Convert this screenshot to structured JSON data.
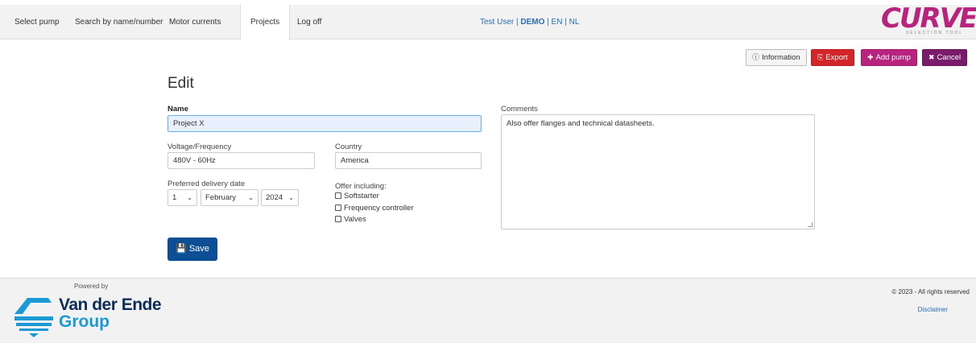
{
  "nav": {
    "items": [
      {
        "label": "Select pump",
        "active": false
      },
      {
        "label": "Search by name/number",
        "active": false
      },
      {
        "label": "Motor currents",
        "active": false
      },
      {
        "label": "Projects",
        "active": true
      },
      {
        "label": "Log off",
        "active": false
      }
    ],
    "user": "Test User",
    "sep1": " | ",
    "account": "DEMO",
    "lang_en": "EN",
    "sep2": " | ",
    "lang_nl": "NL"
  },
  "logo": {
    "text": "CURVES",
    "subtitle": "SELECTION TOOL"
  },
  "actions": {
    "information": "Information",
    "export": "Export",
    "add_pump": "Add pump",
    "cancel": "Cancel"
  },
  "form": {
    "heading": "Edit",
    "name_label": "Name",
    "name_value": "Project X",
    "voltage_label": "Voltage/Frequency",
    "voltage_value": "480V - 60Hz",
    "country_label": "Country",
    "country_value": "America",
    "delivery_label": "Preferred delivery date",
    "day": "1",
    "month": "February",
    "year": "2024",
    "offer_label": "Offer including:",
    "options": [
      "Softstarter",
      "Frequency controller",
      "Valves"
    ],
    "comments_label": "Comments",
    "comments_value": "Also offer flanges and technical datasheets.",
    "save_label": "Save"
  },
  "footer": {
    "powered_by": "Powered by",
    "brand_line1": "Van der Ende",
    "brand_line2": "Group",
    "copyright": "© 2023 - All rights reserved",
    "disclaimer": "Disclaimer"
  },
  "colors": {
    "brand": "#b7237d",
    "primary": "#0d4f94",
    "export": "#d2262a",
    "cancel": "#7b1b6b",
    "link": "#2a6db4"
  }
}
